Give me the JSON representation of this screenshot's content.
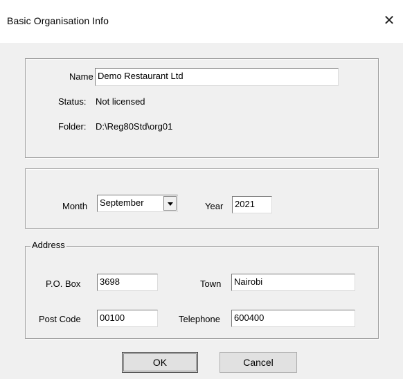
{
  "window": {
    "title": "Basic Organisation Info",
    "close_glyph": "✕"
  },
  "info": {
    "name_label": "Name",
    "name_value": "Demo Restaurant Ltd",
    "status_label": "Status:",
    "status_value": "Not licensed",
    "folder_label": "Folder:",
    "folder_value": "D:\\Reg80Std\\org01"
  },
  "period": {
    "month_label": "Month",
    "month_value": "September",
    "year_label": "Year",
    "year_value": "2021"
  },
  "address": {
    "legend": "Address",
    "pobox_label": "P.O. Box",
    "pobox_value": "3698",
    "town_label": "Town",
    "town_value": "Nairobi",
    "postcode_label": "Post Code",
    "postcode_value": "00100",
    "telephone_label": "Telephone",
    "telephone_value": "600400"
  },
  "buttons": {
    "ok_label": "OK",
    "cancel_label": "Cancel"
  }
}
